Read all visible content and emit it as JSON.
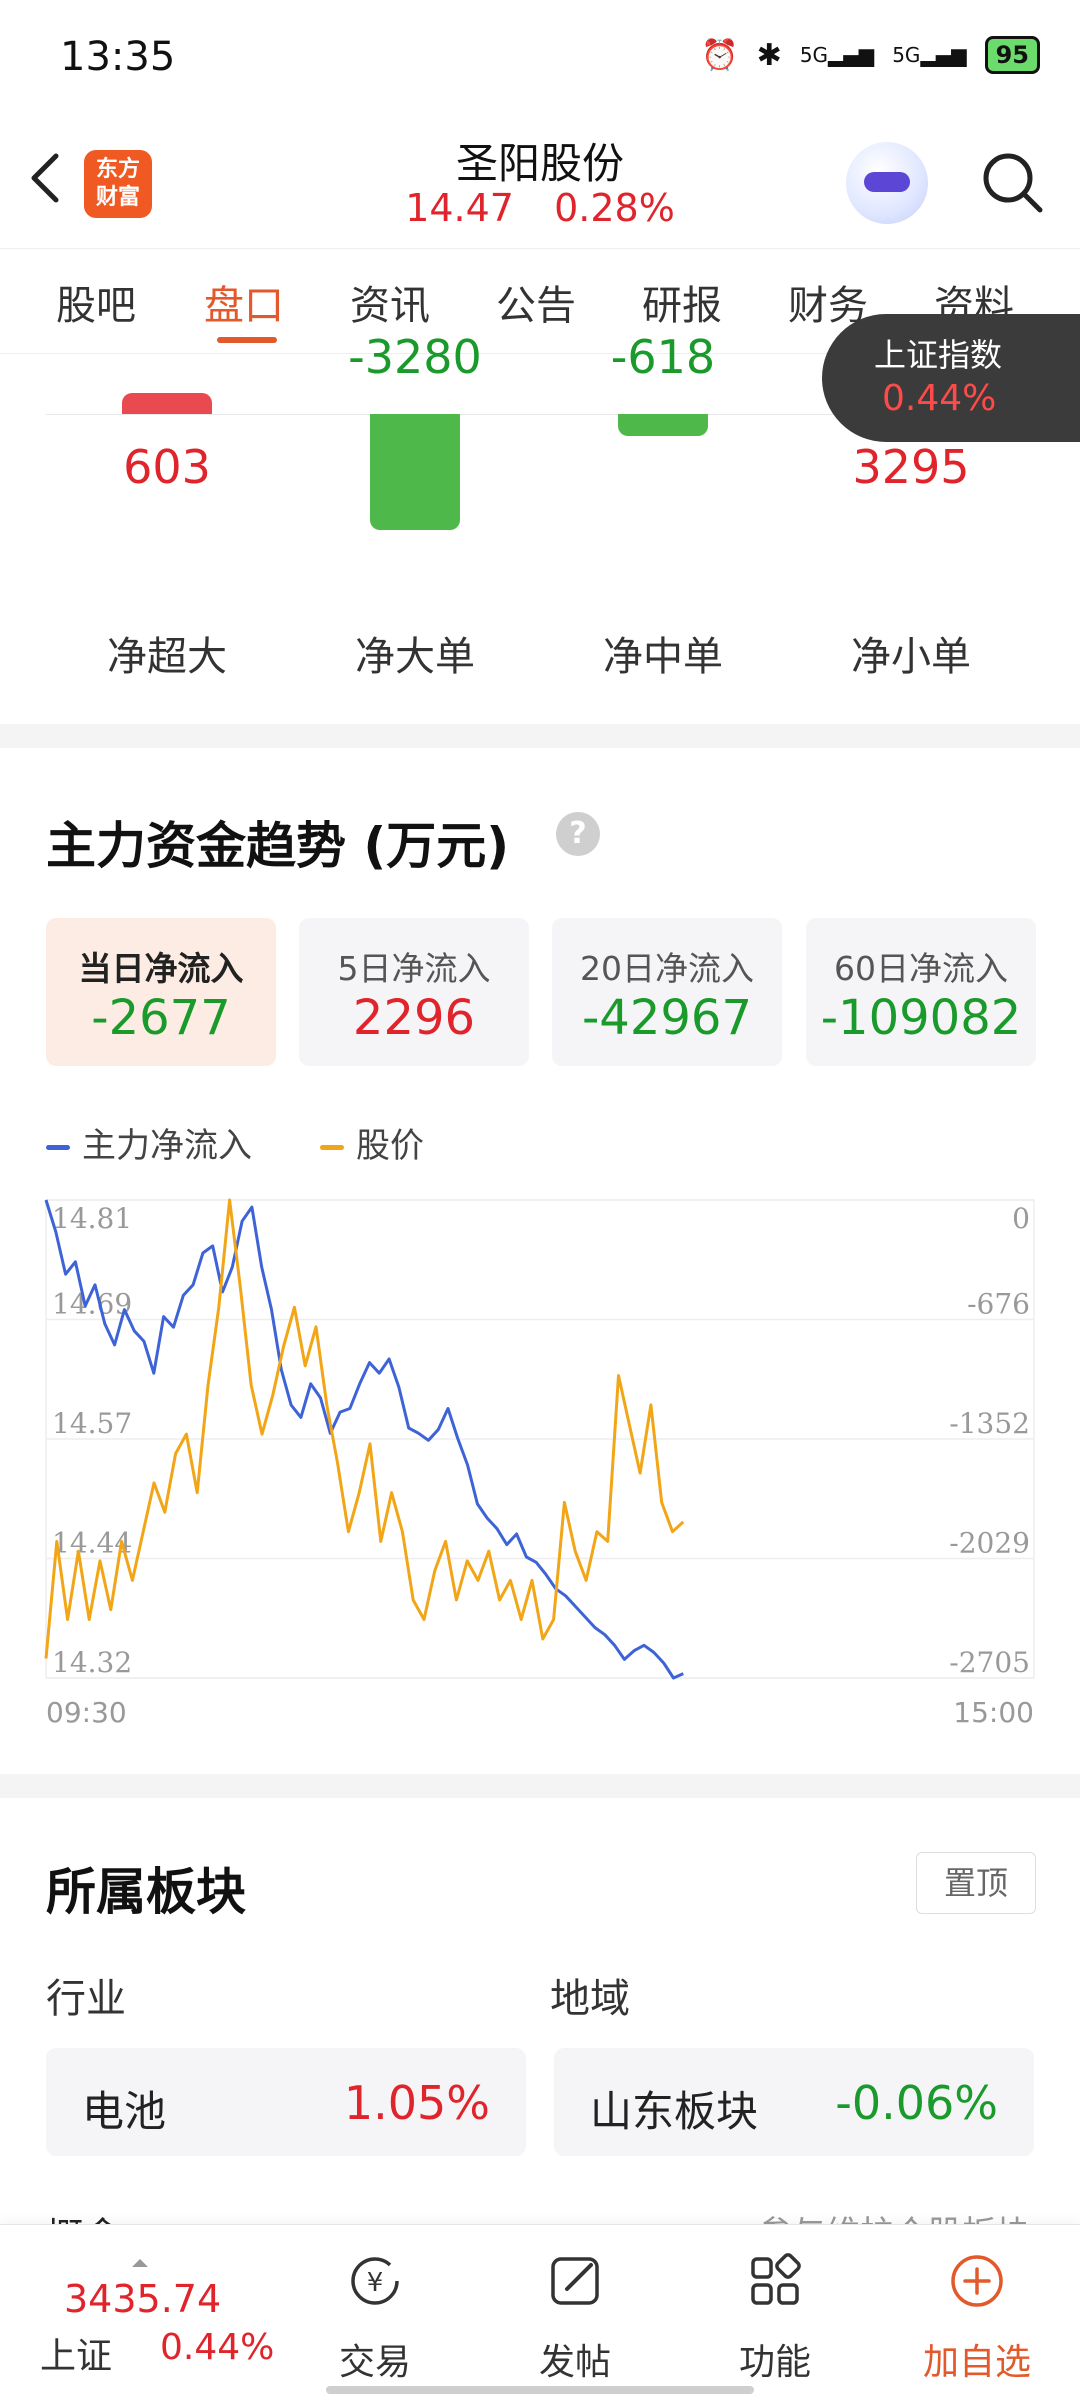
{
  "status_bar": {
    "time": "13:35",
    "signal1": "5G",
    "signal2": "5G",
    "battery": "95"
  },
  "header": {
    "logo_line1": "东方",
    "logo_line2": "财富",
    "title": "圣阳股份",
    "price": "14.47",
    "change_pct": "0.28%"
  },
  "tabs": [
    {
      "label": "股吧"
    },
    {
      "label": "盘口"
    },
    {
      "label": "资讯"
    },
    {
      "label": "公告"
    },
    {
      "label": "研报"
    },
    {
      "label": "财务"
    },
    {
      "label": "资料"
    }
  ],
  "active_tab": "盘口",
  "floating_index": {
    "label": "上证指数",
    "pct": "0.44%"
  },
  "net_flows": [
    {
      "label": "净超大",
      "value": 603
    },
    {
      "label": "净大单",
      "value": -3280
    },
    {
      "label": "净中单",
      "value": -618
    },
    {
      "label": "净小单",
      "value": 3295
    }
  ],
  "trend": {
    "title": "主力资金趋势 (万元)",
    "help": "?",
    "cards": [
      {
        "label": "当日净流入",
        "value": "-2677",
        "active": true
      },
      {
        "label": "5日净流入",
        "value": "2296",
        "active": false
      },
      {
        "label": "20日净流入",
        "value": "-42967",
        "active": false
      },
      {
        "label": "60日净流入",
        "value": "-109082",
        "active": false
      }
    ],
    "legend": [
      {
        "name": "主力净流入",
        "color": "#3d63d6"
      },
      {
        "name": "股价",
        "color": "#f2a516"
      }
    ]
  },
  "chart_data": {
    "type": "line",
    "x_labels": [
      "09:30",
      "15:00"
    ],
    "left_axis_ticks": [
      "14.81",
      "14.69",
      "14.57",
      "14.44",
      "14.32"
    ],
    "right_axis_ticks": [
      "0",
      "-676",
      "-1352",
      "-2029",
      "-2705"
    ],
    "ylim_left": [
      14.32,
      14.81
    ],
    "ylim_right": [
      -2705,
      0
    ],
    "series": [
      {
        "name": "主力净流入",
        "axis": "right",
        "color": "#3d63d6",
        "values": [
          0,
          -180,
          -420,
          -350,
          -600,
          -480,
          -700,
          -820,
          -620,
          -740,
          -800,
          -980,
          -660,
          -720,
          -540,
          -480,
          -300,
          -260,
          -520,
          -380,
          -120,
          -40,
          -380,
          -620,
          -960,
          -1160,
          -1230,
          -1040,
          -1120,
          -1320,
          -1200,
          -1180,
          -1040,
          -920,
          -980,
          -900,
          -1060,
          -1290,
          -1320,
          -1360,
          -1300,
          -1180,
          -1350,
          -1500,
          -1720,
          -1800,
          -1860,
          -1950,
          -1890,
          -2020,
          -2050,
          -2120,
          -2200,
          -2240,
          -2300,
          -2360,
          -2420,
          -2460,
          -2520,
          -2600,
          -2550,
          -2520,
          -2560,
          -2620,
          -2705,
          -2680
        ]
      },
      {
        "name": "股价",
        "axis": "left",
        "color": "#f2a516",
        "values": [
          14.34,
          14.46,
          14.38,
          14.45,
          14.38,
          14.44,
          14.39,
          14.46,
          14.42,
          14.47,
          14.52,
          14.49,
          14.55,
          14.57,
          14.51,
          14.62,
          14.7,
          14.81,
          14.72,
          14.62,
          14.57,
          14.61,
          14.66,
          14.7,
          14.64,
          14.68,
          14.6,
          14.54,
          14.47,
          14.51,
          14.56,
          14.46,
          14.51,
          14.47,
          14.4,
          14.38,
          14.43,
          14.46,
          14.4,
          14.44,
          14.42,
          14.45,
          14.4,
          14.42,
          14.38,
          14.42,
          14.36,
          14.38,
          14.5,
          14.45,
          14.42,
          14.47,
          14.46,
          14.63,
          14.58,
          14.53,
          14.6,
          14.5,
          14.47,
          14.48
        ]
      }
    ]
  },
  "sector": {
    "title": "所属板块",
    "pin_label": "置顶",
    "industry_label": "行业",
    "region_label": "地域",
    "industry": {
      "name": "电池",
      "pct": "1.05%"
    },
    "region": {
      "name": "山东板块",
      "pct": "-0.06%"
    },
    "peek_left": "概念",
    "peek_right": "参与维护个股板块"
  },
  "bottom_nav": {
    "index_value": "3435.74",
    "index_name": "上证",
    "index_pct": "0.44%",
    "items": [
      {
        "label": "交易"
      },
      {
        "label": "发帖"
      },
      {
        "label": "功能"
      },
      {
        "label": "加自选"
      }
    ]
  }
}
